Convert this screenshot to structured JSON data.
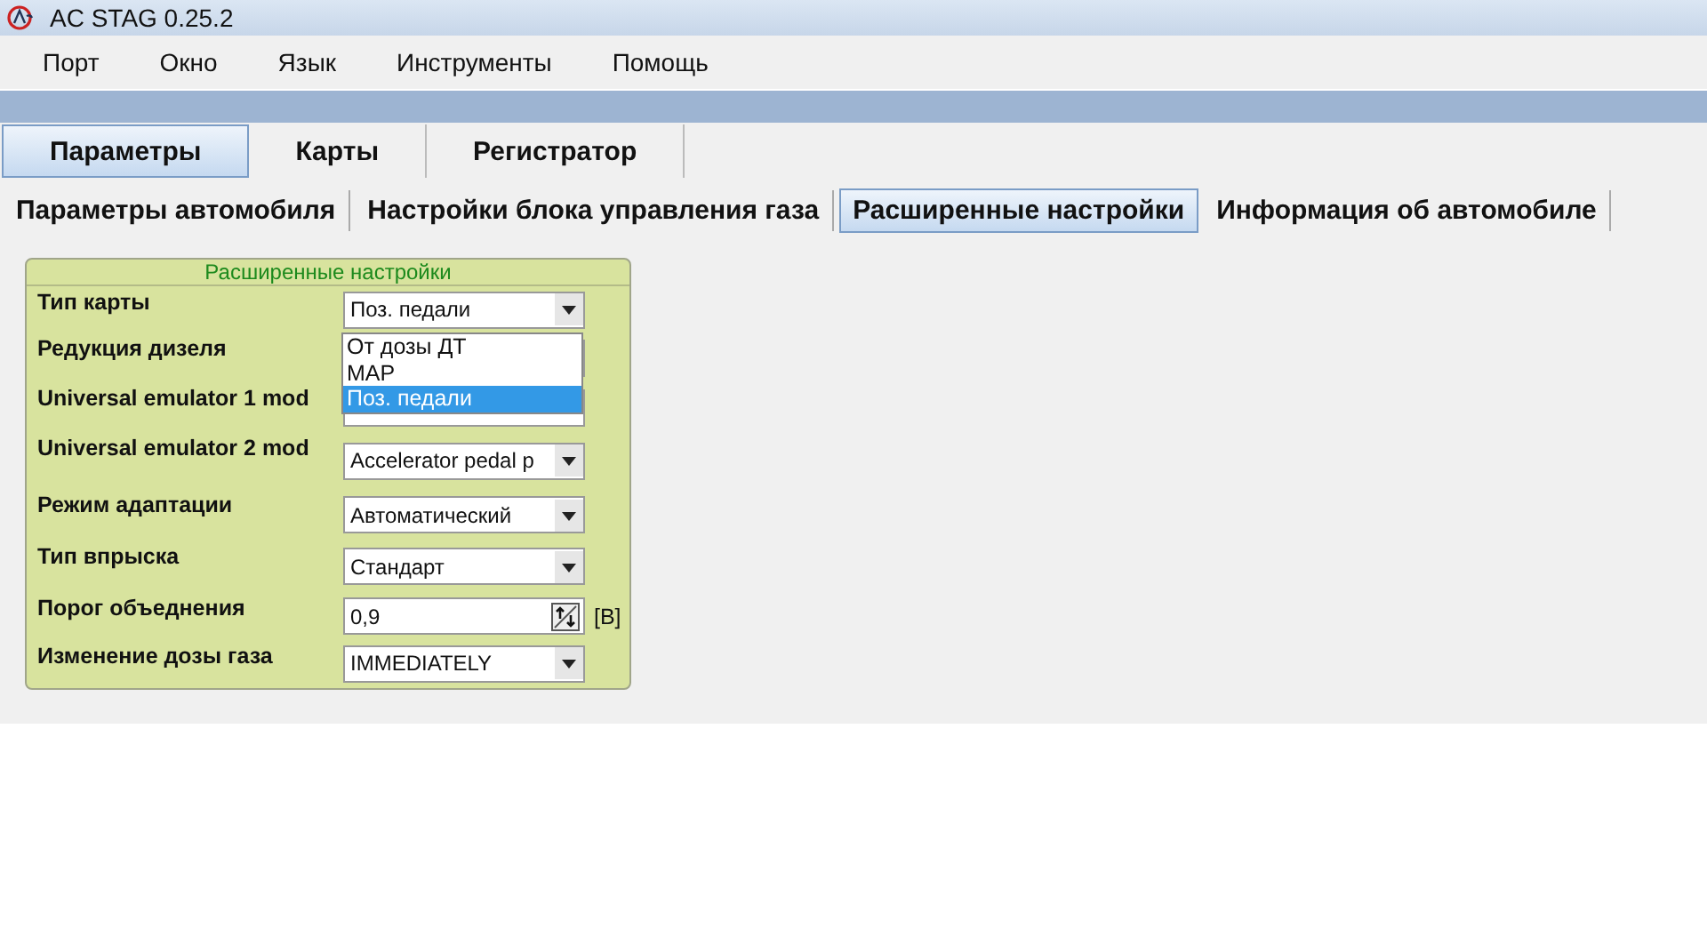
{
  "window": {
    "title": "AC STAG 0.25.2"
  },
  "menu": [
    "Порт",
    "Окно",
    "Язык",
    "Инструменты",
    "Помощь"
  ],
  "tabs": [
    {
      "label": "Параметры",
      "selected": true
    },
    {
      "label": "Карты",
      "selected": false
    },
    {
      "label": "Регистратор",
      "selected": false
    }
  ],
  "subtabs": [
    {
      "label": "Параметры автомобиля",
      "selected": false
    },
    {
      "label": "Настройки блока управления газа",
      "selected": false
    },
    {
      "label": "Расширенные настройки",
      "selected": true
    },
    {
      "label": "Информация об автомобиле",
      "selected": false
    }
  ],
  "panel": {
    "title": "Расширенные настройки",
    "rows": [
      {
        "label": "Тип карты",
        "kind": "select",
        "value": "Поз. педали"
      },
      {
        "label": "Редукция дизеля",
        "kind": "select"
      },
      {
        "label": "Universal emulator 1 mod",
        "kind": "select"
      },
      {
        "label": "Universal emulator 2 mod",
        "kind": "select",
        "value": "Accelerator pedal p"
      },
      {
        "label": "Режим адаптации",
        "kind": "select",
        "value": "Автоматический"
      },
      {
        "label": "Тип впрыска",
        "kind": "select",
        "value": "Стандарт"
      },
      {
        "label": "Порог объеднения",
        "kind": "spin",
        "value": "0,9",
        "unit": "[В]"
      },
      {
        "label": "Изменение дозы газа",
        "kind": "select",
        "value": "IMMEDIATELY"
      }
    ],
    "open_list": [
      {
        "label": "От дозы ДТ",
        "selected": false
      },
      {
        "label": "MAP",
        "selected": false
      },
      {
        "label": "Поз. педали",
        "selected": true
      }
    ]
  }
}
